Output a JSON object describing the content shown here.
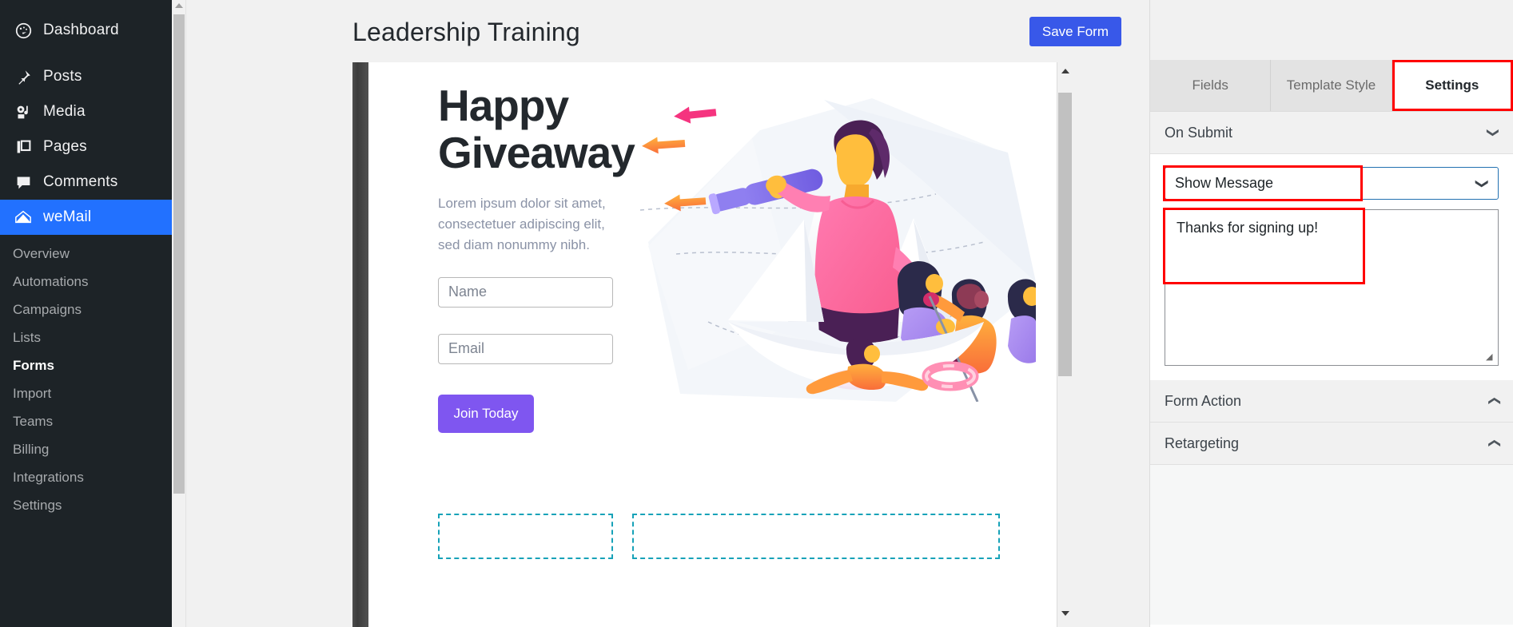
{
  "wp_sidebar": {
    "top_items": [
      {
        "label": "Dashboard",
        "icon": "dashboard-icon"
      },
      {
        "label": "Posts",
        "icon": "pin-icon"
      },
      {
        "label": "Media",
        "icon": "media-icon"
      },
      {
        "label": "Pages",
        "icon": "pages-icon"
      },
      {
        "label": "Comments",
        "icon": "comment-icon"
      },
      {
        "label": "weMail",
        "icon": "envelope-icon",
        "active": true
      }
    ],
    "sub_items": [
      {
        "label": "Overview"
      },
      {
        "label": "Automations"
      },
      {
        "label": "Campaigns"
      },
      {
        "label": "Lists"
      },
      {
        "label": "Forms",
        "current": true
      },
      {
        "label": "Import"
      },
      {
        "label": "Teams"
      },
      {
        "label": "Billing"
      },
      {
        "label": "Integrations"
      },
      {
        "label": "Settings"
      }
    ],
    "active_color": "#2271ff"
  },
  "topbar": {
    "page_title": "Leadership Training",
    "save_button": "Save Form"
  },
  "preview": {
    "hero_title_line1": "Happy",
    "hero_title_line2": "Giveaway",
    "hero_subtitle": "Lorem ipsum dolor sit amet, consectetuer adipiscing elit, sed diam nonummy nibh.",
    "name_placeholder": "Name",
    "email_placeholder": "Email",
    "submit_button": "Join Today",
    "button_color": "#7f56f0",
    "dropzone_color": "#17a2b8"
  },
  "settings": {
    "tabs": [
      {
        "label": "Fields",
        "active": false
      },
      {
        "label": "Template Style",
        "active": false
      },
      {
        "label": "Settings",
        "active": true,
        "highlighted": true
      }
    ],
    "sections": [
      {
        "label": "On Submit",
        "expanded": true,
        "chevron": "chevron-down"
      },
      {
        "label": "Form Action",
        "expanded": false,
        "chevron": "chevron-up"
      },
      {
        "label": "Retargeting",
        "expanded": false,
        "chevron": "chevron-up"
      }
    ],
    "on_submit": {
      "select_value": "Show Message",
      "select_highlighted": true,
      "message_value": "Thanks for signing up!",
      "message_highlighted": true
    },
    "highlight_color": "#ff0000"
  }
}
